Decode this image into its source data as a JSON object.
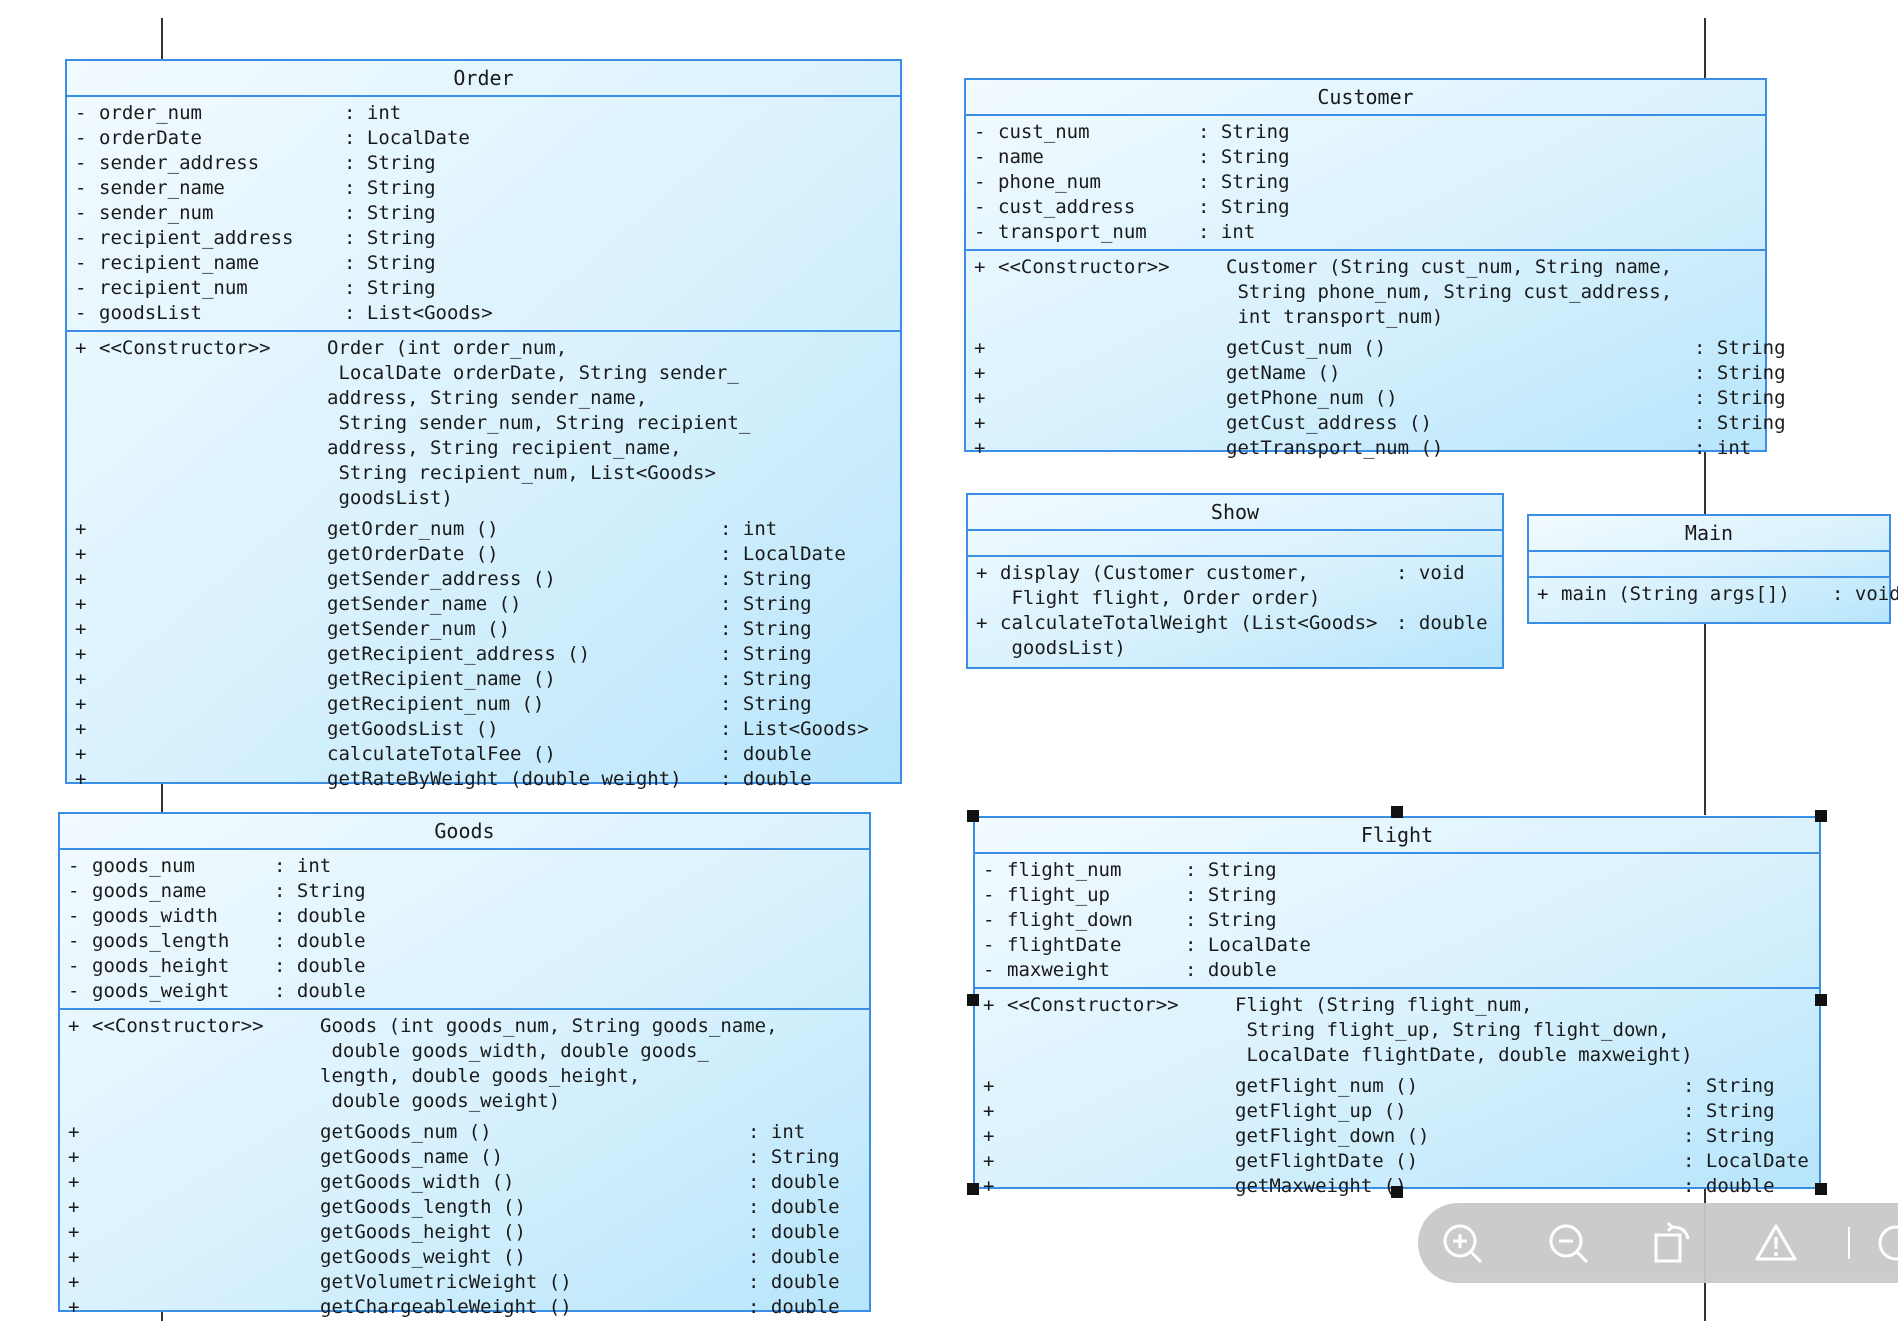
{
  "classes": {
    "order": {
      "name": "Order",
      "attributes": [
        [
          "-",
          "order_num",
          "int"
        ],
        [
          "-",
          "orderDate",
          "LocalDate"
        ],
        [
          "-",
          "sender_address",
          "String"
        ],
        [
          "-",
          "sender_name",
          "String"
        ],
        [
          "-",
          "sender_num",
          "String"
        ],
        [
          "-",
          "recipient_address",
          "String"
        ],
        [
          "-",
          "recipient_name",
          "String"
        ],
        [
          "-",
          "recipient_num",
          "String"
        ],
        [
          "-",
          "goodsList",
          "List<Goods>"
        ]
      ],
      "constructor": {
        "vis": "+",
        "keyword": "<<Constructor>>",
        "signature": "Order (int order_num,\n LocalDate orderDate, String sender_\naddress, String sender_name,\n String sender_num, String recipient_\naddress, String recipient_name,\n String recipient_num, List<Goods>\n goodsList)"
      },
      "methods": [
        [
          "+",
          "getOrder_num ()",
          "int"
        ],
        [
          "+",
          "getOrderDate ()",
          "LocalDate"
        ],
        [
          "+",
          "getSender_address ()",
          "String"
        ],
        [
          "+",
          "getSender_name ()",
          "String"
        ],
        [
          "+",
          "getSender_num ()",
          "String"
        ],
        [
          "+",
          "getRecipient_address ()",
          "String"
        ],
        [
          "+",
          "getRecipient_name ()",
          "String"
        ],
        [
          "+",
          "getRecipient_num ()",
          "String"
        ],
        [
          "+",
          "getGoodsList ()",
          "List<Goods>"
        ],
        [
          "+",
          "calculateTotalFee ()",
          "double"
        ],
        [
          "+",
          "getRateByWeight (double weight)",
          "double"
        ]
      ]
    },
    "customer": {
      "name": "Customer",
      "attributes": [
        [
          "-",
          "cust_num",
          "String"
        ],
        [
          "-",
          "name",
          "String"
        ],
        [
          "-",
          "phone_num",
          "String"
        ],
        [
          "-",
          "cust_address",
          "String"
        ],
        [
          "-",
          "transport_num",
          "int"
        ]
      ],
      "constructor": {
        "vis": "+",
        "keyword": "<<Constructor>>",
        "signature": "Customer (String cust_num, String name,\n String phone_num, String cust_address,\n int transport_num)"
      },
      "methods": [
        [
          "+",
          "getCust_num ()",
          "String"
        ],
        [
          "+",
          "getName ()",
          "String"
        ],
        [
          "+",
          "getPhone_num ()",
          "String"
        ],
        [
          "+",
          "getCust_address ()",
          "String"
        ],
        [
          "+",
          "getTransport_num ()",
          "int"
        ]
      ]
    },
    "show": {
      "name": "Show",
      "methods": [
        [
          "+",
          "display (Customer customer,\n Flight flight, Order order)",
          "void"
        ],
        [
          "+",
          "calculateTotalWeight (List<Goods>\n goodsList)",
          "double"
        ]
      ]
    },
    "main": {
      "name": "Main",
      "methods": [
        [
          "+",
          "main (String args[])",
          "void"
        ]
      ]
    },
    "goods": {
      "name": "Goods",
      "attributes": [
        [
          "-",
          "goods_num",
          "int"
        ],
        [
          "-",
          "goods_name",
          "String"
        ],
        [
          "-",
          "goods_width",
          "double"
        ],
        [
          "-",
          "goods_length",
          "double"
        ],
        [
          "-",
          "goods_height",
          "double"
        ],
        [
          "-",
          "goods_weight",
          "double"
        ]
      ],
      "constructor": {
        "vis": "+",
        "keyword": "<<Constructor>>",
        "signature": "Goods (int goods_num, String goods_name,\n double goods_width, double goods_\nlength, double goods_height,\n double goods_weight)"
      },
      "methods": [
        [
          "+",
          "getGoods_num ()",
          "int"
        ],
        [
          "+",
          "getGoods_name ()",
          "String"
        ],
        [
          "+",
          "getGoods_width ()",
          "double"
        ],
        [
          "+",
          "getGoods_length ()",
          "double"
        ],
        [
          "+",
          "getGoods_height ()",
          "double"
        ],
        [
          "+",
          "getGoods_weight ()",
          "double"
        ],
        [
          "+",
          "getVolumetricWeight ()",
          "double"
        ],
        [
          "+",
          "getChargeableWeight ()",
          "double"
        ]
      ]
    },
    "flight": {
      "name": "Flight",
      "attributes": [
        [
          "-",
          "flight_num",
          "String"
        ],
        [
          "-",
          "flight_up",
          "String"
        ],
        [
          "-",
          "flight_down",
          "String"
        ],
        [
          "-",
          "flightDate",
          "LocalDate"
        ],
        [
          "-",
          "maxweight",
          "double"
        ]
      ],
      "constructor": {
        "vis": "+",
        "keyword": "<<Constructor>>",
        "signature": "Flight (String flight_num,\n String flight_up, String flight_down,\n LocalDate flightDate, double maxweight)"
      },
      "methods": [
        [
          "+",
          "getFlight_num ()",
          "String"
        ],
        [
          "+",
          "getFlight_up ()",
          "String"
        ],
        [
          "+",
          "getFlight_down ()",
          "String"
        ],
        [
          "+",
          "getFlightDate ()",
          "LocalDate"
        ],
        [
          "+",
          "getMaxweight ()",
          "double"
        ]
      ]
    }
  },
  "toolbar": {
    "icons": [
      "zoom-in-icon",
      "zoom-out-icon",
      "rotate-icon",
      "warning-icon",
      "more-icon"
    ]
  }
}
